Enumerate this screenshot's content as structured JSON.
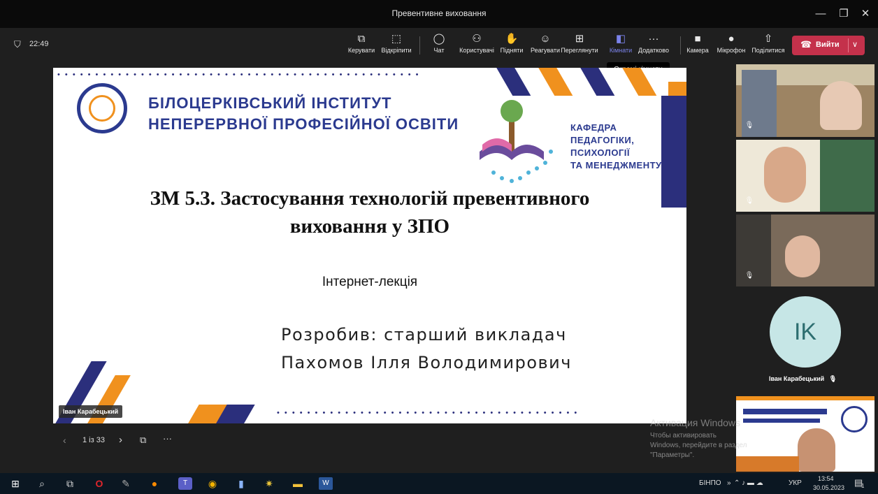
{
  "window": {
    "title": "Превентивне виховання"
  },
  "meeting": {
    "elapsed": "22:49"
  },
  "toolbar": {
    "items": [
      {
        "label": "Керувати",
        "icon": "share-screen-icon"
      },
      {
        "label": "Відкріпити",
        "icon": "unpin-icon"
      },
      {
        "label": "Чат",
        "icon": "chat-icon"
      },
      {
        "label": "Користувачі",
        "icon": "people-icon"
      },
      {
        "label": "Підняти",
        "icon": "raise-hand-icon"
      },
      {
        "label": "Реагувати",
        "icon": "emoji-icon"
      },
      {
        "label": "Переглянути",
        "icon": "view-icon"
      },
      {
        "label": "Кімнати",
        "icon": "rooms-icon"
      },
      {
        "label": "Додатково",
        "icon": "more-icon"
      },
      {
        "label": "Камера",
        "icon": "camera-icon"
      },
      {
        "label": "Мікрофон",
        "icon": "microphone-icon"
      },
      {
        "label": "Поділитися",
        "icon": "share-icon"
      }
    ],
    "leave_label": "Вийти",
    "active_color": "#7b83eb",
    "leave_color": "#c4314b"
  },
  "tooltip": "Окремі кімнати",
  "slide": {
    "institute_line1": "БІЛОЦЕРКІВСЬКИЙ ІНСТИТУТ",
    "institute_line2": "НЕПЕРЕРВНОЇ ПРОФЕСІЙНОЇ ОСВІТИ",
    "department": [
      "КАФЕДРА",
      "ПЕДАГОГІКИ,",
      "ПСИХОЛОГІЇ",
      "ТА МЕНЕДЖМЕНТУ"
    ],
    "title_line1": "ЗМ 5.3. Застосування технологій превентивного",
    "title_line2": "виховання у ЗПО",
    "subtitle": "Інтернет-лекція",
    "author_line1": "Розробив: старший викладач",
    "author_line2": "Пахомов Ілля Володимирович",
    "brand_navy": "#2b2f7c",
    "brand_orange": "#f0911e"
  },
  "presenter_tag": "Іван Карабецький",
  "slide_nav": {
    "counter": "1 із 33"
  },
  "participants": {
    "avatar_initials": "IK",
    "avatar_name": "Іван Карабецький"
  },
  "activation": {
    "line1": "Активация Windows",
    "line2": "Чтобы активировать Windows, перейдите в раздел \"Параметры\"."
  },
  "taskbar": {
    "network": "БІНПО",
    "lang": "УКР",
    "time": "13:54",
    "date": "30.05.2023",
    "notifications": "1"
  }
}
